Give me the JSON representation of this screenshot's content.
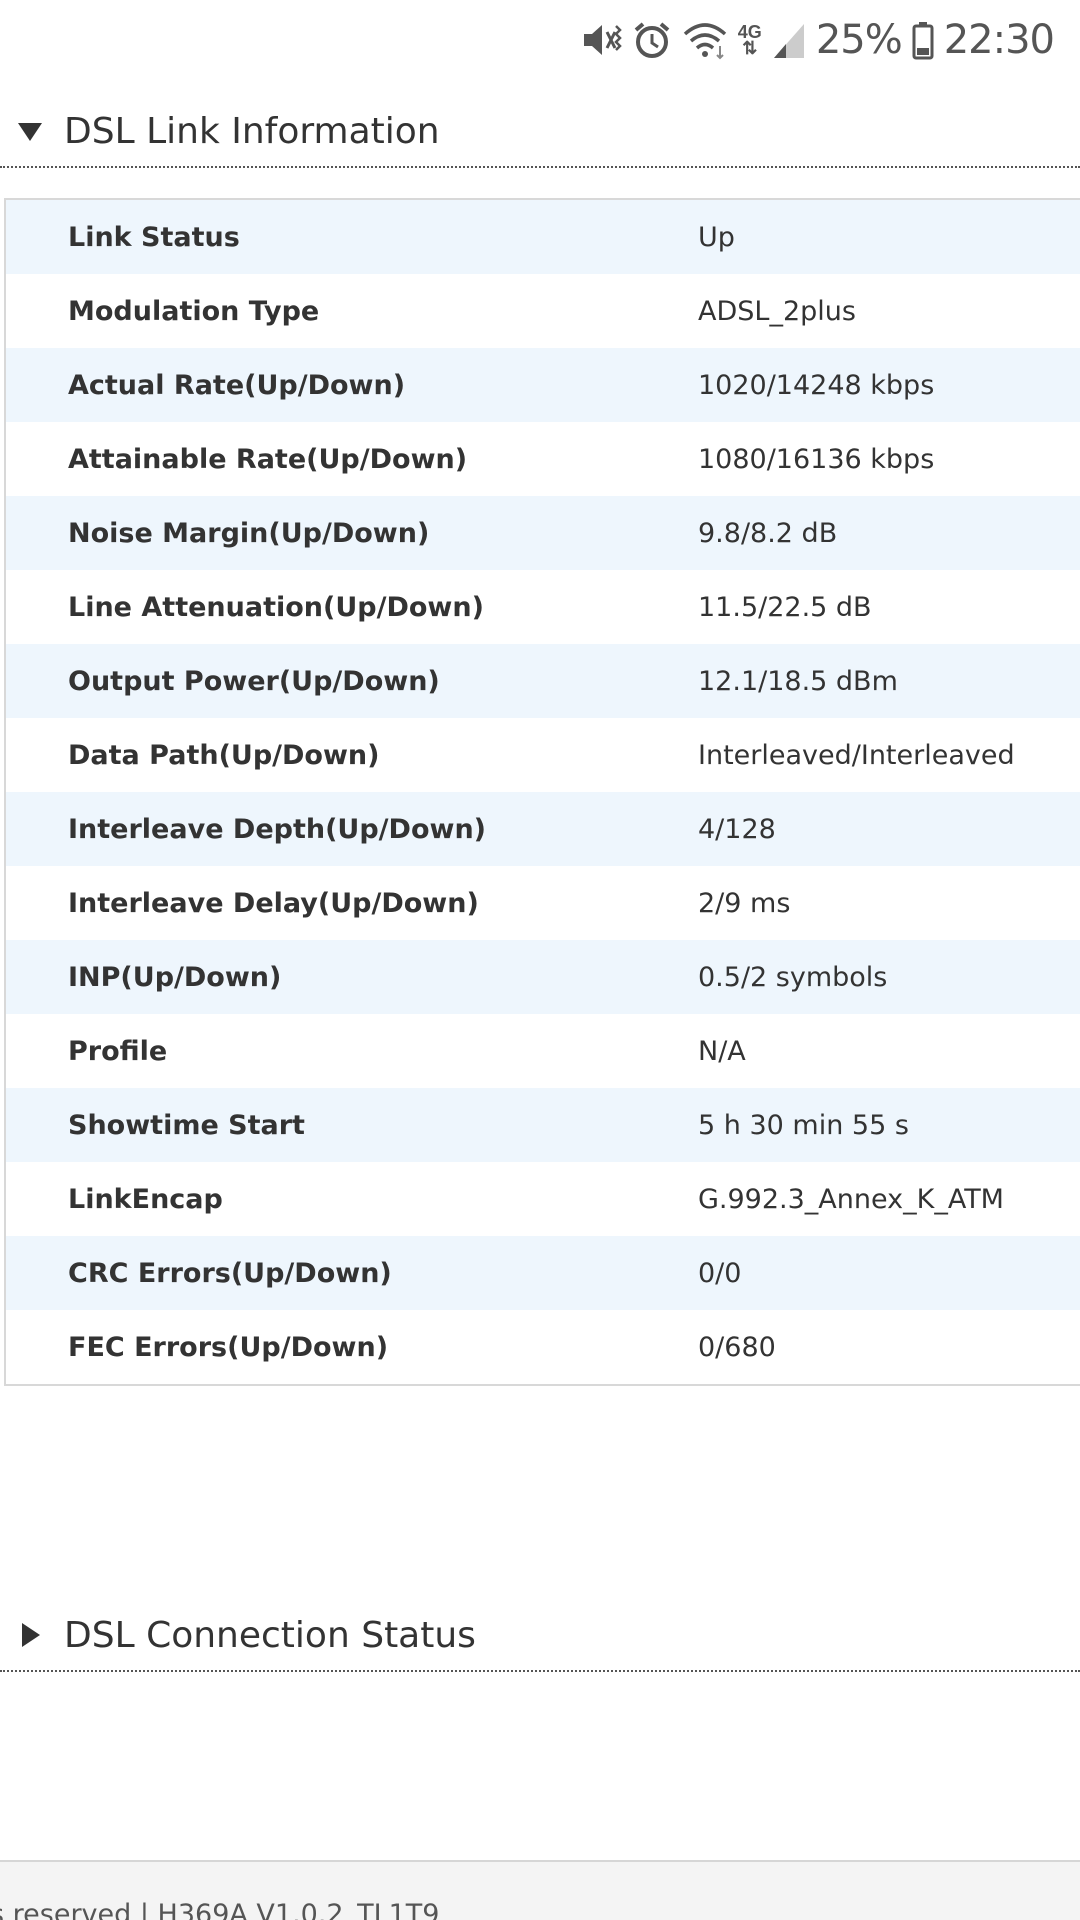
{
  "status_bar": {
    "battery_percent": "25%",
    "time": "22:30",
    "network_type": "4G",
    "icons": [
      "mute-vibrate-icon",
      "alarm-icon",
      "wifi-icon",
      "network-4g-icon",
      "signal-icon",
      "battery-icon"
    ]
  },
  "sections": {
    "link_info": {
      "title": "DSL Link Information",
      "expanded": true
    },
    "connection_status": {
      "title": "DSL Connection Status",
      "expanded": false
    }
  },
  "table": {
    "rows": [
      {
        "label": "Link Status",
        "value": "Up"
      },
      {
        "label": "Modulation Type",
        "value": "ADSL_2plus"
      },
      {
        "label": "Actual Rate(Up/Down)",
        "value": "1020/14248 kbps"
      },
      {
        "label": "Attainable Rate(Up/Down)",
        "value": "1080/16136 kbps"
      },
      {
        "label": "Noise Margin(Up/Down)",
        "value": "9.8/8.2 dB"
      },
      {
        "label": "Line Attenuation(Up/Down)",
        "value": "11.5/22.5 dB"
      },
      {
        "label": "Output Power(Up/Down)",
        "value": "12.1/18.5 dBm"
      },
      {
        "label": "Data Path(Up/Down)",
        "value": "Interleaved/Interleaved"
      },
      {
        "label": "Interleave Depth(Up/Down)",
        "value": "4/128"
      },
      {
        "label": "Interleave Delay(Up/Down)",
        "value": "2/9 ms"
      },
      {
        "label": "INP(Up/Down)",
        "value": "0.5/2 symbols"
      },
      {
        "label": "Profile",
        "value": "N/A"
      },
      {
        "label": "Showtime Start",
        "value": "5 h 30 min 55 s"
      },
      {
        "label": "LinkEncap",
        "value": "G.992.3_Annex_K_ATM"
      },
      {
        "label": "CRC Errors(Up/Down)",
        "value": "0/0"
      },
      {
        "label": "FEC Errors(Up/Down)",
        "value": "0/680"
      }
    ]
  },
  "footer": {
    "text": "s reserved  |   H369A V1.0.2_TL1T9"
  },
  "colors": {
    "row_alt": "#eef6fd",
    "text": "#333333",
    "footer_bg": "#f4f4f4"
  }
}
